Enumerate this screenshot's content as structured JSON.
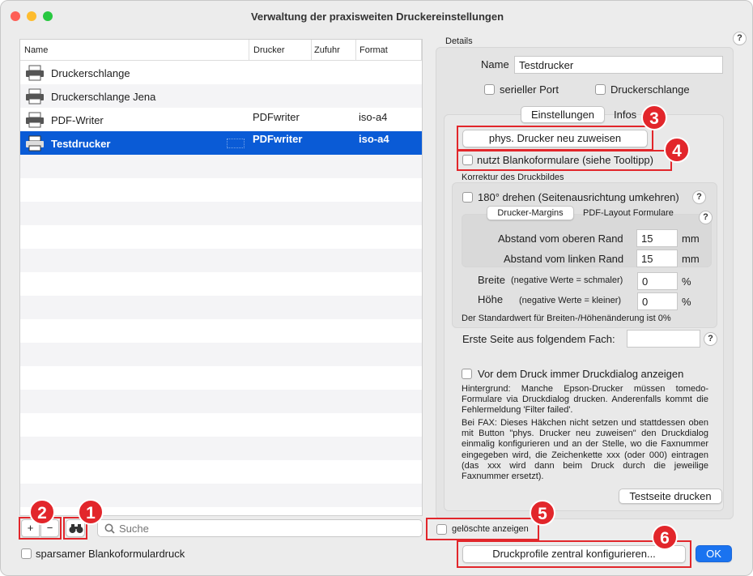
{
  "window": {
    "title": "Verwaltung der praxisweiten Druckereinstellungen"
  },
  "table": {
    "columns": [
      "Name",
      "Drucker",
      "Zufuhr",
      "Format"
    ],
    "rows": [
      {
        "name": "Druckerschlange",
        "printer": "",
        "feed": "",
        "format": ""
      },
      {
        "name": "Druckerschlange Jena",
        "printer": "",
        "feed": "",
        "format": ""
      },
      {
        "name": "PDF-Writer",
        "printer": "PDFwriter",
        "feed": "",
        "format": "iso-a4"
      },
      {
        "name": "Testdrucker",
        "printer": "PDFwriter",
        "feed": "",
        "format": "iso-a4"
      }
    ]
  },
  "bottom_left": {
    "add_label": "+",
    "remove_label": "−",
    "search_placeholder": "Suche",
    "sparse_label": "sparsamer Blankoformulardruck"
  },
  "details": {
    "section_label": "Details",
    "help": "?",
    "name_label": "Name",
    "name_value": "Testdrucker",
    "serial_port_label": "serieller Port",
    "queue_label": "Druckerschlange",
    "tabs": [
      "Einstellungen",
      "Infos"
    ],
    "reassign_button": "phys. Drucker neu zuweisen",
    "blank_forms_label": "nutzt Blankoformulare (siehe Tooltipp)",
    "correction_label": "Korrektur des Druckbildes",
    "rotate_label": "180° drehen (Seitenausrichtung umkehren)",
    "subtabs": [
      "Drucker-Margins",
      "PDF-Layout Formulare"
    ],
    "top_margin_label": "Abstand vom oberen Rand",
    "top_margin_value": "15",
    "left_margin_label": "Abstand vom linken Rand",
    "left_margin_value": "15",
    "mm": "mm",
    "width_label": "Breite",
    "width_hint": "(negative Werte = schmaler)",
    "width_value": "0",
    "height_label": "Höhe",
    "height_hint": "(negative Werte = kleiner)",
    "height_value": "0",
    "percent": "%",
    "default_note": "Der Standardwert für Breiten-/Höhenänderung ist 0%",
    "first_page_label": "Erste Seite aus folgendem Fach:",
    "first_page_value": "",
    "print_dialog_label": "Vor dem Druck immer Druckdialog anzeigen",
    "background_text": "Hintergrund: Manche Epson-Drucker müssen tomedo-Formulare via Druckdialog drucken. Anderenfalls kommt die Fehlermeldung 'Filter failed'.",
    "fax_text": "Bei FAX: Dieses Häkchen nicht setzen und stattdessen oben mit Button \"phys. Drucker neu zuweisen\" den Druckdialog einmalig konfigurieren und an der Stelle, wo die Faxnummer eingegeben wird, die Zeichenkette xxx (oder 000) eintragen (das xxx wird dann beim Druck durch die jeweilige Faxnummer ersetzt).",
    "test_print_button": "Testseite drucken"
  },
  "footer": {
    "show_deleted_label": "gelöschte anzeigen",
    "configure_button": "Druckprofile zentral konfigurieren...",
    "ok_button": "OK"
  },
  "badges": [
    "1",
    "2",
    "3",
    "4",
    "5",
    "6"
  ],
  "colors": {
    "accent": "#0a5bd6",
    "annotation": "#e2262b"
  }
}
